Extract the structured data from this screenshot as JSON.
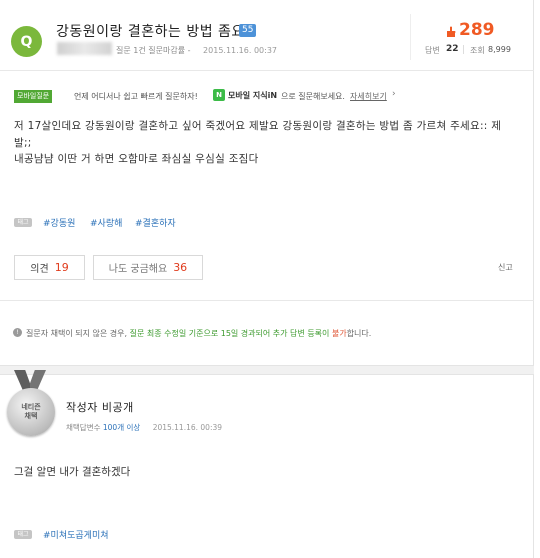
{
  "question": {
    "badge": "Q",
    "title": "강동원이랑 결혼하는 방법 좀요",
    "level": "55",
    "meta": "질문 1건 질문마감률 -",
    "time": "2015.11.16. 00:37",
    "count": "289",
    "answers_label": "답변",
    "answers": "22",
    "views_label": "조회",
    "views": "8,999"
  },
  "banner": {
    "badge": "모바일질문",
    "text": "언제 어디서나 쉽고 빠르게 질문하자!",
    "kin_icon": "N",
    "kin_bold": "모바일 지식iN",
    "kin_rest": "으로 질문해보세요.",
    "link": "자세히보기"
  },
  "body": {
    "line1": "저 17살인데요 강동원이랑 결혼하고 싶어 죽겠어요 제발요 강동원이랑 결혼하는 방법 좀 가르쳐 주세요:: 제",
    "line2": "발;;",
    "line3": "내공냠냠 이딴 거 하면 오함마로 좌심실 우심실 조짐다"
  },
  "tags": {
    "icon_label": "태그",
    "items": [
      "#강동원",
      "#사랑해",
      "#결혼하자"
    ]
  },
  "actions": {
    "opinion_label": "의견",
    "opinion_count": "19",
    "curious_label": "나도 궁금해요",
    "curious_count": "36",
    "report": "신고"
  },
  "notice": {
    "icon": "!",
    "part1": "질문자 채택이 되지 않은 경우,",
    "part2": "질문 최종 수정일 기준으로 15일 경과되어 추가 답변 등록이",
    "part3": "불가",
    "part4": "합니다."
  },
  "answer": {
    "medal_line1": "네티즌",
    "medal_line2": "채택",
    "author": "작성자 비공개",
    "meta_label": "채택답변수",
    "meta_value": "100개 이상",
    "time": "2015.11.16. 00:39",
    "body": "그걸 알면 내가 결혼하겠다",
    "tag_icon": "태그",
    "tag": "#미쳐도곱게미쳐"
  },
  "colors": {
    "accent_green": "#7bb83c",
    "count_orange": "#f05a24",
    "tag_blue": "#2b71b8"
  }
}
